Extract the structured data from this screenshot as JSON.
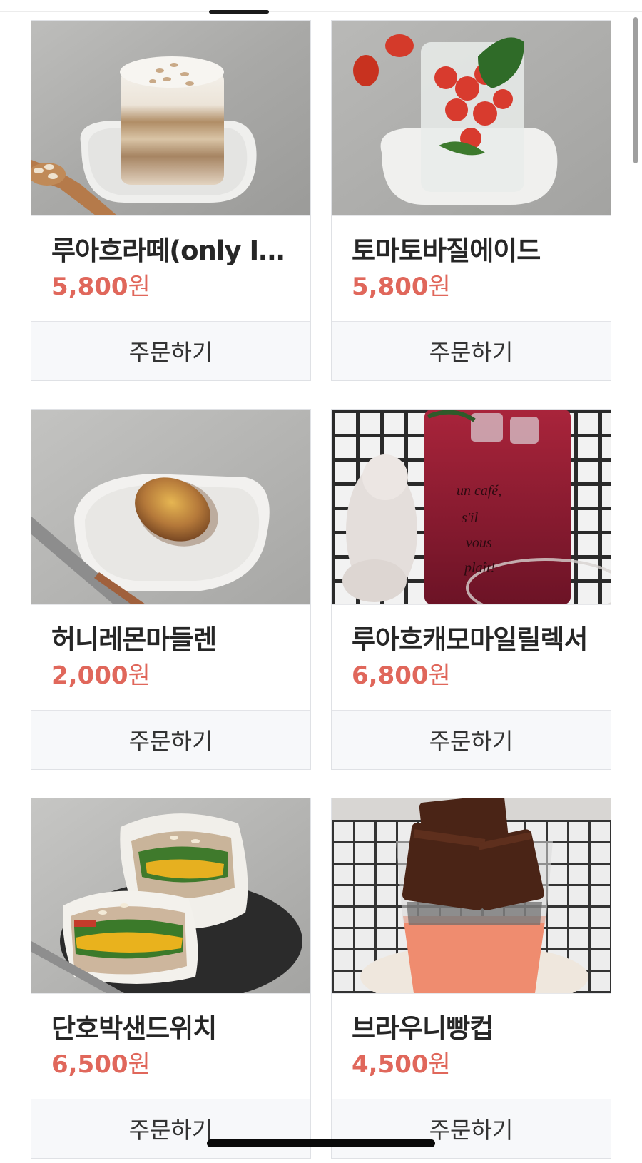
{
  "products": [
    {
      "name": "루아흐라떼(only Ic...",
      "price": "5,800",
      "currency": "원",
      "order_label": "주문하기",
      "image_icon": "iced-latte-photo"
    },
    {
      "name": "토마토바질에이드",
      "price": "5,800",
      "currency": "원",
      "order_label": "주문하기",
      "image_icon": "tomato-basil-ade-photo"
    },
    {
      "name": "허니레몬마들렌",
      "price": "2,000",
      "currency": "원",
      "order_label": "주문하기",
      "image_icon": "madeleine-photo"
    },
    {
      "name": "루아흐캐모마일릴렉서",
      "price": "6,800",
      "currency": "원",
      "order_label": "주문하기",
      "image_icon": "red-iced-tea-photo"
    },
    {
      "name": "단호박샌드위치",
      "price": "6,500",
      "currency": "원",
      "order_label": "주문하기",
      "image_icon": "sandwich-photo"
    },
    {
      "name": "브라우니빵컵",
      "price": "4,500",
      "currency": "원",
      "order_label": "주문하기",
      "image_icon": "brownie-cup-photo"
    }
  ],
  "image_texts": {
    "cafe_cup_writing": [
      "un café,",
      "s'il",
      "vous",
      "plaît!"
    ]
  },
  "colors": {
    "price": "#e0675b",
    "order_bg": "#f7f8fa",
    "border": "#dfe1e5"
  }
}
